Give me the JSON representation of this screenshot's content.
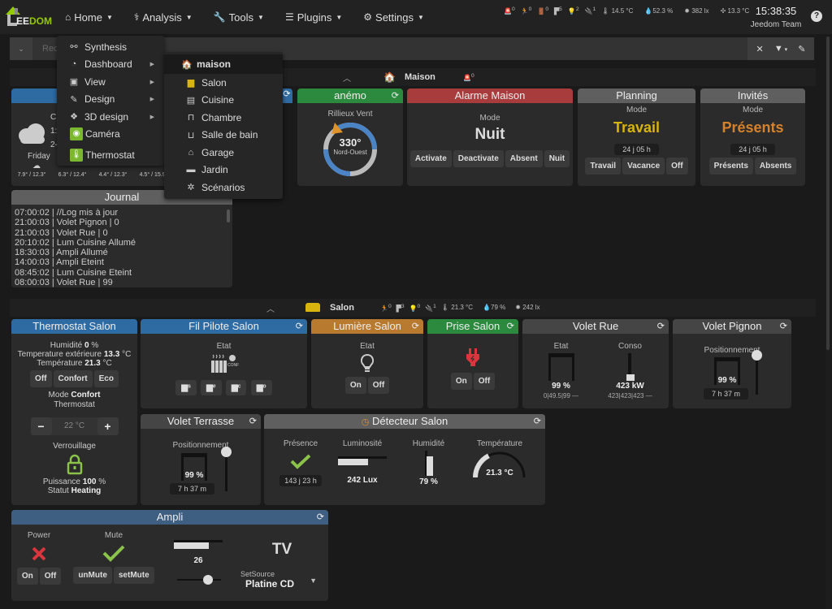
{
  "navbar": {
    "logo": {
      "prefix": "EE",
      "suffix": "DOM"
    },
    "menu": [
      {
        "label": "Home",
        "icon": "home-icon"
      },
      {
        "label": "Analysis",
        "icon": "stethoscope-icon"
      },
      {
        "label": "Tools",
        "icon": "wrench-icon"
      },
      {
        "label": "Plugins",
        "icon": "tasks-icon"
      },
      {
        "label": "Settings",
        "icon": "gear-icon"
      }
    ],
    "summary": [
      {
        "icon": "alarm-icon",
        "value": "0"
      },
      {
        "icon": "motion-icon",
        "value": "0"
      },
      {
        "icon": "door-icon",
        "value": "0"
      },
      {
        "icon": "shutter-icon",
        "value": "5"
      },
      {
        "icon": "light-icon",
        "value": "2"
      },
      {
        "icon": "plug-icon",
        "value": "1"
      },
      {
        "icon": "thermometer-icon",
        "value": "14.5 °C"
      },
      {
        "icon": "humidity-icon",
        "value": "52.3 %"
      },
      {
        "icon": "luminosity-icon",
        "value": "382 lx"
      },
      {
        "icon": "outdoor-temp-icon",
        "value": "13.3 °C"
      }
    ],
    "time": "15:38:35",
    "user": "Jeedom Team",
    "help": "?"
  },
  "search": {
    "placeholder": "Rec"
  },
  "home_menu": {
    "items": [
      {
        "label": "Synthesis",
        "icon": "synthesis-icon",
        "submenu": false
      },
      {
        "label": "Dashboard",
        "icon": "dashboard-icon",
        "submenu": true
      },
      {
        "label": "View",
        "icon": "picture-icon",
        "submenu": true
      },
      {
        "label": "Design",
        "icon": "brush-icon",
        "submenu": true
      },
      {
        "label": "3D design",
        "icon": "cubes-icon",
        "submenu": true
      },
      {
        "label": "Caméra",
        "icon": "camera-plugin-icon",
        "submenu": false
      },
      {
        "label": "Thermostat",
        "icon": "thermostat-plugin-icon",
        "submenu": false
      }
    ]
  },
  "dashboard_menu": {
    "items": [
      {
        "label": "maison",
        "icon": "house-icon"
      },
      {
        "label": "Salon",
        "icon": "sofa-icon"
      },
      {
        "label": "Cuisine",
        "icon": "kitchen-icon"
      },
      {
        "label": "Chambre",
        "icon": "bed-icon"
      },
      {
        "label": "Salle de bain",
        "icon": "bath-icon"
      },
      {
        "label": "Garage",
        "icon": "garage-icon"
      },
      {
        "label": "Jardin",
        "icon": "garden-icon"
      },
      {
        "label": "Scénarios",
        "icon": "scenario-icon"
      }
    ]
  },
  "maison": {
    "name": "Maison",
    "summary": [
      {
        "icon": "alarm-icon",
        "value": "0"
      }
    ],
    "weather": {
      "days": [
        {
          "name": "Friday",
          "temps": "7.9° / 12.3°"
        },
        {
          "name": "",
          "temps": "6.3° / 12.4°"
        },
        {
          "name": "",
          "temps": "4.4° / 12.3°"
        },
        {
          "name": "",
          "temps": "4.5° / 15.9°"
        }
      ],
      "partial_lines": [
        "C",
        "1:",
        "2-"
      ]
    },
    "anemo": {
      "title": "anémo",
      "label": "Rillieux Vent",
      "degrees": "330°",
      "direction": "Nord-Ouest",
      "angle": 330
    },
    "alarme": {
      "title": "Alarme Maison",
      "mode_label": "Mode",
      "mode": "Nuit",
      "buttons": [
        "Activate",
        "Deactivate",
        "Absent",
        "Nuit"
      ]
    },
    "planning": {
      "title": "Planning",
      "mode_label": "Mode",
      "mode": "Travail",
      "since": "24 j 05 h",
      "buttons": [
        "Travail",
        "Vacance",
        "Off"
      ]
    },
    "invites": {
      "title": "Invités",
      "mode_label": "Mode",
      "mode": "Présents",
      "since": "24 j 05 h",
      "buttons": [
        "Présents",
        "Absents"
      ]
    },
    "journal": {
      "title": "Journal",
      "lines": [
        "07:00:02 | //Log mis à jour",
        "21:00:03 | Volet Pignon | 0",
        "21:00:03 | Volet Rue | 0",
        "20:10:02 | Lum Cuisine Allumé",
        "18:30:03 | Ampli Allumé",
        "14:00:03 | Ampli Eteint",
        "08:45:02 | Lum Cuisine Eteint",
        "08:00:03 | Volet Rue | 99"
      ]
    }
  },
  "salon": {
    "name": "Salon",
    "summary": [
      {
        "icon": "motion-icon",
        "value": "0"
      },
      {
        "icon": "shutter-icon",
        "value": "3"
      },
      {
        "icon": "light-icon",
        "value": "0"
      },
      {
        "icon": "plug-icon",
        "value": "1"
      },
      {
        "icon": "thermometer-icon",
        "value": "21.3 °C"
      },
      {
        "icon": "humidity-icon",
        "value": "79 %"
      },
      {
        "icon": "luminosity-icon",
        "value": "242 lx"
      }
    ],
    "thermostat": {
      "title": "Thermostat Salon",
      "humidity_label": "Humidité",
      "humidity": "0",
      "humidity_unit": "%",
      "ext_label": "Temperature extérieure",
      "ext": "13.3",
      "ext_unit": "°C",
      "temp_label": "Température",
      "temp": "21.3",
      "temp_unit": "°C",
      "buttons": [
        "Off",
        "Confort",
        "Eco"
      ],
      "mode_label": "Mode",
      "mode": "Confort",
      "thermostat_label": "Thermostat",
      "setpoint": "22 °C",
      "minus": "−",
      "plus": "+",
      "lock_label": "Verrouillage",
      "power_label": "Puissance",
      "power": "100",
      "power_unit": "%",
      "status_label": "Statut",
      "status": "Heating"
    },
    "fil_pilote": {
      "title": "Fil Pilote Salon",
      "label": "Etat",
      "state_icon": "radiator-confort-icon",
      "buttons": [
        "radiator-hors-gel-icon",
        "radiator-eco-icon",
        "radiator-confort-icon",
        "radiator-off-icon"
      ]
    },
    "lumiere": {
      "title": "Lumière Salon",
      "label": "Etat",
      "buttons": [
        "On",
        "Off"
      ]
    },
    "prise": {
      "title": "Prise Salon",
      "buttons": [
        "On",
        "Off"
      ]
    },
    "volet_rue": {
      "title": "Volet Rue",
      "etat_label": "Etat",
      "etat": "99 %",
      "etat_stats": "0|49.5|99 —",
      "etat_level": 0.99,
      "conso_label": "Conso",
      "conso": "423 kW",
      "conso_stats": "423|423|423 —",
      "conso_level": 0.1
    },
    "volet_pignon": {
      "title": "Volet Pignon",
      "label": "Positionnement",
      "value": "99 %",
      "since": "7 h 37 m",
      "level": 0.99
    },
    "volet_terrasse": {
      "title": "Volet Terrasse",
      "label": "Positionnement",
      "value": "99 %",
      "since": "7 h 37 m",
      "level": 0.99
    },
    "detecteur": {
      "title": "Détecteur Salon",
      "presence_label": "Présence",
      "presence_since": "143 j 23 h",
      "lum_label": "Luminosité",
      "lum": "242 Lux",
      "lum_level": 0.62,
      "hum_label": "Humidité",
      "hum": "79 %",
      "hum_level": 0.79,
      "temp_label": "Température",
      "temp": "21.3 °C",
      "temp_level": 0.35
    },
    "ampli": {
      "title": "Ampli",
      "power_label": "Power",
      "power_buttons": [
        "On",
        "Off"
      ],
      "mute_label": "Mute",
      "mute_buttons": [
        "unMute",
        "setMute"
      ],
      "volume": "26",
      "volume_level": 0.72,
      "slider_level": 0.7,
      "source": "TV",
      "setsource_label": "SetSource",
      "setsource_value": "Platine CD"
    }
  }
}
